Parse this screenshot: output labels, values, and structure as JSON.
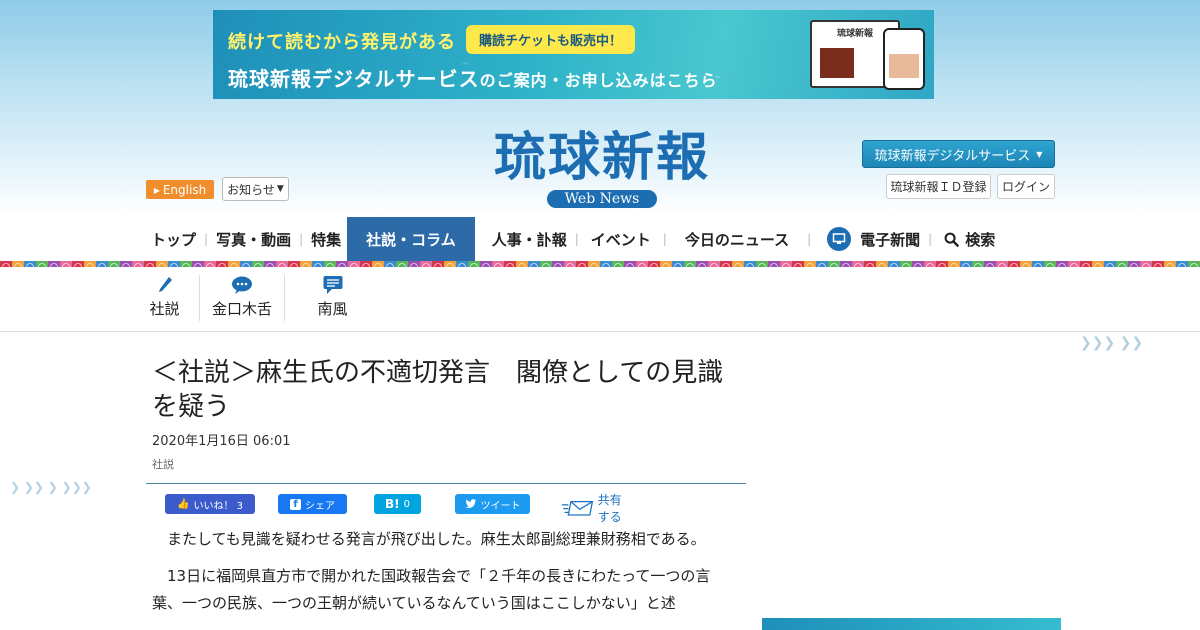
{
  "banner": {
    "line1": "続けて読むから発見がある",
    "badge": "購読チケットも販売中！",
    "line2_a": "琉球新報デジタルサービス",
    "line2_b": "のご案内・お申し込み",
    "line2_c": "はこちら",
    "monitor_title": "琉球新報"
  },
  "header": {
    "english": "English",
    "notice": "お知らせ",
    "logo": "琉球新報",
    "logo_sub": "Web News",
    "digital_service": "琉球新報デジタルサービス",
    "id_register": "琉球新報ＩＤ登録",
    "login": "ログイン"
  },
  "nav": {
    "items": [
      "トップ",
      "写真・動画",
      "特集",
      "社説・コラム",
      "人事・訃報",
      "イベント",
      "今日のニュース",
      "電子新聞",
      "検索"
    ]
  },
  "subnav": {
    "items": [
      "社説",
      "金口木舌",
      "南風"
    ]
  },
  "article": {
    "title": "＜社説＞麻生氏の不適切発言　閣僚としての見識を疑う",
    "date": "2020年1月16日 06:01",
    "category": "社説",
    "share": {
      "like": "いいね！ 3",
      "fb_share": "シェア",
      "hatena_count": "0",
      "tweet": "ツイート",
      "share_label": "共有する"
    },
    "paragraphs": [
      "またしても見識を疑わせる発言が飛び出した。麻生太郎副総理兼財務相である。",
      "13日に福岡県直方市で開かれた国政報告会で「２千年の長きにわたって一つの言葉、一つの民族、一つの王朝が続いているなんていう国はここしかない」と述"
    ]
  },
  "colors": {
    "brand_blue": "#1c6db2",
    "active_nav": "#2d6aa8",
    "english_btn": "#f08d2d"
  }
}
